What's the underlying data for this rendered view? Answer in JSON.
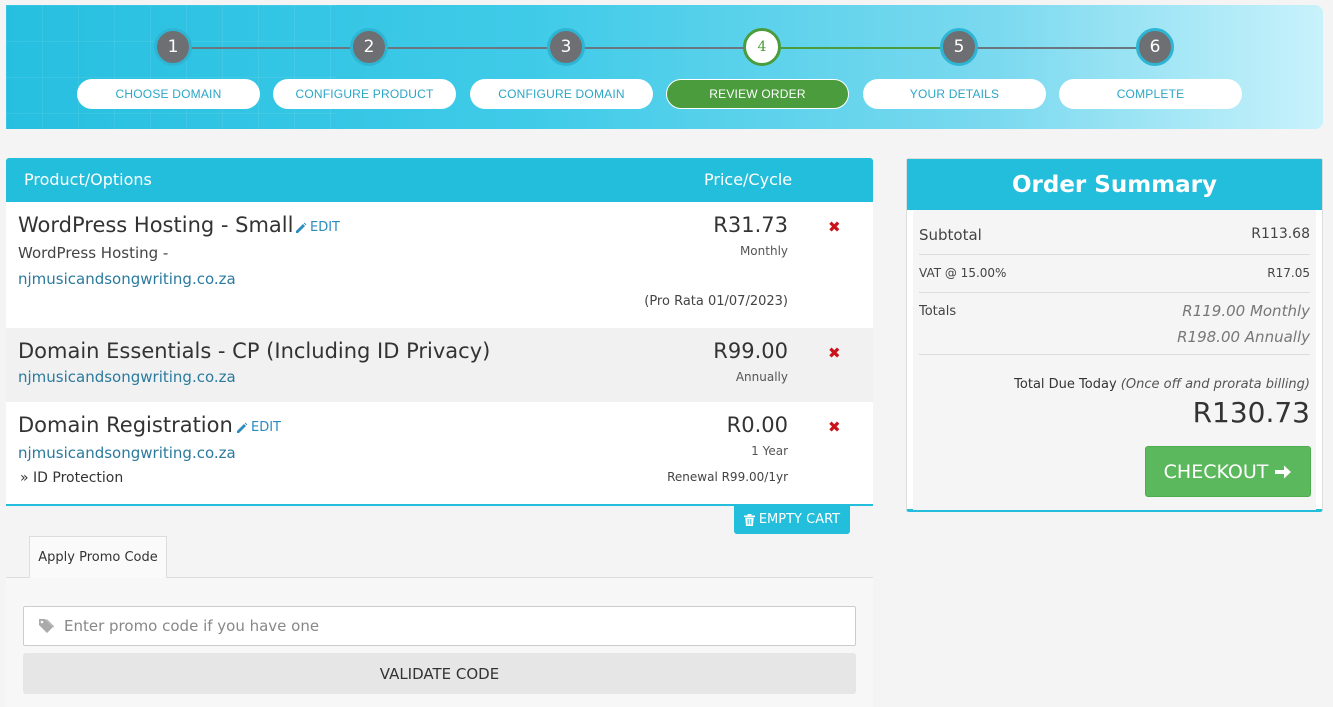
{
  "steps": [
    {
      "number": "1",
      "label": "CHOOSE DOMAIN"
    },
    {
      "number": "2",
      "label": "CONFIGURE PRODUCT"
    },
    {
      "number": "3",
      "label": "CONFIGURE DOMAIN"
    },
    {
      "number": "4",
      "label": "REVIEW ORDER"
    },
    {
      "number": "5",
      "label": "YOUR DETAILS"
    },
    {
      "number": "6",
      "label": "COMPLETE"
    }
  ],
  "active_step": 4,
  "cart": {
    "header": {
      "product": "Product/Options",
      "price": "Price/Cycle"
    },
    "items": [
      {
        "name": "WordPress Hosting - Small",
        "edit_label": "EDIT",
        "subtitle": "WordPress Hosting -",
        "domain": "njmusicandsongwriting.co.za",
        "price": "R31.73",
        "cycle": "Monthly",
        "note": "(Pro Rata 01/07/2023)"
      },
      {
        "name": "Domain Essentials - CP (Including ID Privacy)",
        "domain": "njmusicandsongwriting.co.za",
        "price": "R99.00",
        "cycle": "Annually"
      },
      {
        "name": "Domain Registration",
        "edit_label": "EDIT",
        "domain": "njmusicandsongwriting.co.za",
        "extra": "» ID Protection",
        "price": "R0.00",
        "cycle": "1 Year",
        "note": "Renewal R99.00/1yr"
      }
    ],
    "remove_glyph": "✖",
    "empty_cart_label": "EMPTY CART"
  },
  "promo": {
    "tab_label": "Apply Promo Code",
    "placeholder": "Enter promo code if you have one",
    "validate_label": "VALIDATE CODE"
  },
  "summary": {
    "title": "Order Summary",
    "subtotal_label": "Subtotal",
    "subtotal_value": "R113.68",
    "vat_label": "VAT @ 15.00%",
    "vat_value": "R17.05",
    "totals_label": "Totals",
    "totals_monthly": "R119.00 Monthly",
    "totals_annually": "R198.00 Annually",
    "due_label": "Total Due Today",
    "due_note": "(Once off and prorata billing)",
    "due_amount": "R130.73",
    "checkout_label": "CHECKOUT"
  },
  "colors": {
    "accent": "#22bedb",
    "active_step": "#4a9c3c",
    "checkout": "#5cb85c",
    "remove": "#c8141a"
  },
  "icons": {
    "edit": "pencil-icon",
    "remove": "close-icon",
    "empty_cart": "trash-icon",
    "promo": "tag-icon",
    "checkout": "arrow-right-icon"
  }
}
